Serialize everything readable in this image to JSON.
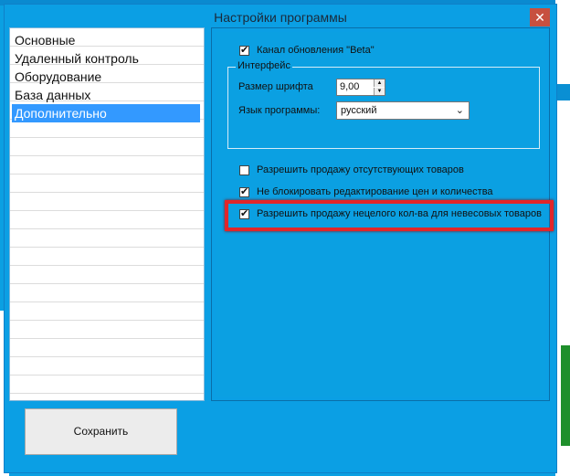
{
  "window": {
    "title": "Настройки программы",
    "close_symbol": "✕"
  },
  "nav": {
    "items": [
      {
        "label": "Основные"
      },
      {
        "label": "Удаленный контроль"
      },
      {
        "label": "Оборудование"
      },
      {
        "label": "База данных"
      },
      {
        "label": "Дополнительно",
        "selected": true
      }
    ]
  },
  "options": {
    "beta_channel": {
      "label": "Канал обновления \"Beta\"",
      "checked": true
    },
    "allow_missing_goods": {
      "label": "Разрешить продажу отсутствующих товаров",
      "checked": false
    },
    "no_block_price_edit": {
      "label": "Не блокировать редактирование цен и количества",
      "checked": true
    },
    "allow_fractional_qty": {
      "label": "Разрешить продажу нецелого кол-ва для невесовых товаров",
      "checked": true
    }
  },
  "interface_group": {
    "title": "Интерфейс",
    "font_size_label": "Размер шрифта",
    "font_size_value": "9,00",
    "language_label": "Язык программы:",
    "language_value": "русский"
  },
  "buttons": {
    "save": "Сохранить"
  },
  "colors": {
    "dialog_bg": "#0ba0e2",
    "selected_item": "#3399ff",
    "highlight": "#e1262a"
  }
}
